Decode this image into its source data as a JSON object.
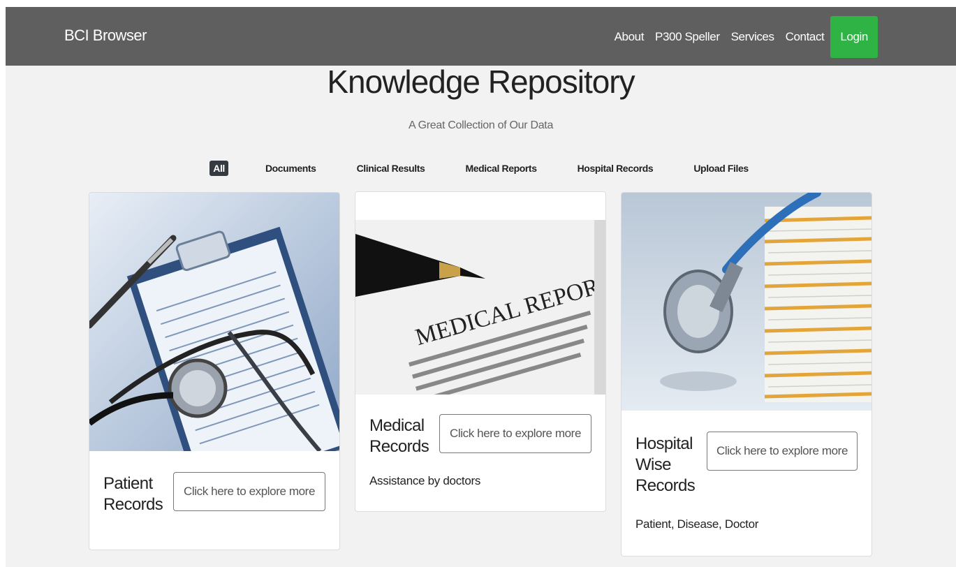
{
  "navbar": {
    "brand": "BCI Browser",
    "links": [
      "About",
      "P300 Speller",
      "Services",
      "Contact"
    ],
    "login_label": "Login",
    "login_color": "#2fb344"
  },
  "header": {
    "title": "Knowledge Repository",
    "subtitle": "A Great Collection of Our Data"
  },
  "filters": {
    "items": [
      "All",
      "Documents",
      "Clinical Results",
      "Medical Reports",
      "Hospital Records",
      "Upload Files"
    ],
    "active": "All"
  },
  "cards": [
    {
      "title_line1": "Patient",
      "title_line2": "Records",
      "button": "Click here to explore more",
      "text": "",
      "image": "patient-medical-history-clipboard-stethoscope"
    },
    {
      "title_line1": "Medical",
      "title_line2": "Records",
      "button": "Click here to explore more",
      "text": "Assistance by doctors",
      "image": "medical-report-pen",
      "image_text": "MEDICAL REPORT"
    },
    {
      "title_line1": "Hospital",
      "title_line2": "Wise",
      "title_line3": "Records",
      "button": "Click here to explore more",
      "text": "Patient, Disease, Doctor",
      "image": "stethoscope-file-stack"
    }
  ]
}
